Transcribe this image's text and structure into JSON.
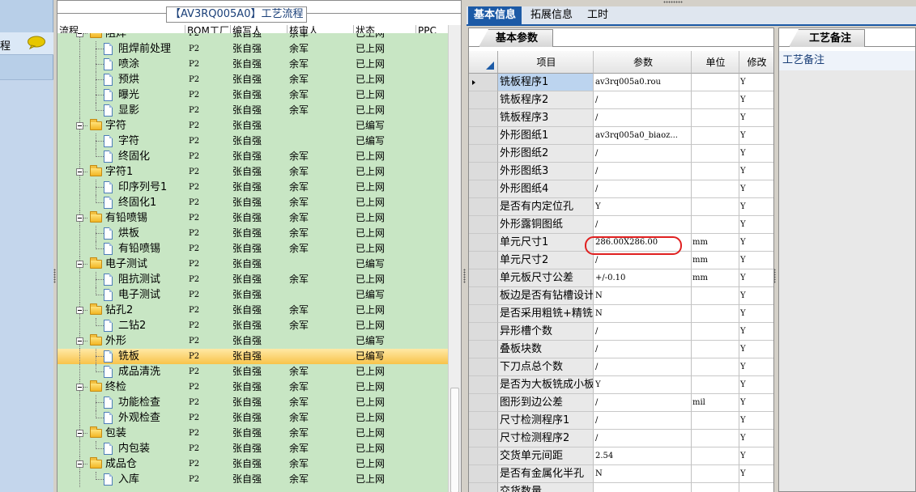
{
  "left_strip": {
    "title": "程"
  },
  "tree": {
    "caption": "【AV3RQ005A0】工艺流程",
    "columns": [
      "流程",
      "BOM工厂",
      "编写人",
      "核审人",
      "状态",
      "PPC"
    ],
    "rows": [
      {
        "level": 0,
        "type": "folder",
        "name": "阻焊",
        "bom": "P2",
        "writer": "张自强",
        "reviewer": "余军",
        "status": "已上网",
        "ppc": ""
      },
      {
        "level": 1,
        "type": "doc",
        "name": "阻焊前处理",
        "bom": "P2",
        "writer": "张自强",
        "reviewer": "余军",
        "status": "已上网",
        "ppc": ""
      },
      {
        "level": 1,
        "type": "doc",
        "name": "喷涂",
        "bom": "P2",
        "writer": "张自强",
        "reviewer": "余军",
        "status": "已上网",
        "ppc": ""
      },
      {
        "level": 1,
        "type": "doc",
        "name": "预烘",
        "bom": "P2",
        "writer": "张自强",
        "reviewer": "余军",
        "status": "已上网",
        "ppc": ""
      },
      {
        "level": 1,
        "type": "doc",
        "name": "曝光",
        "bom": "P2",
        "writer": "张自强",
        "reviewer": "余军",
        "status": "已上网",
        "ppc": ""
      },
      {
        "level": 1,
        "type": "doc",
        "name": "显影",
        "bom": "P2",
        "writer": "张自强",
        "reviewer": "余军",
        "status": "已上网",
        "ppc": ""
      },
      {
        "level": 0,
        "type": "folder",
        "name": "字符",
        "bom": "P2",
        "writer": "张自强",
        "reviewer": "",
        "status": "已编写",
        "ppc": ""
      },
      {
        "level": 1,
        "type": "doc",
        "name": "字符",
        "bom": "P2",
        "writer": "张自强",
        "reviewer": "",
        "status": "已编写",
        "ppc": ""
      },
      {
        "level": 1,
        "type": "doc",
        "name": "终固化",
        "bom": "P2",
        "writer": "张自强",
        "reviewer": "余军",
        "status": "已上网",
        "ppc": ""
      },
      {
        "level": 0,
        "type": "folder",
        "name": "字符1",
        "bom": "P2",
        "writer": "张自强",
        "reviewer": "余军",
        "status": "已上网",
        "ppc": ""
      },
      {
        "level": 1,
        "type": "doc",
        "name": "印序列号1",
        "bom": "P2",
        "writer": "张自强",
        "reviewer": "余军",
        "status": "已上网",
        "ppc": ""
      },
      {
        "level": 1,
        "type": "doc",
        "name": "终固化1",
        "bom": "P2",
        "writer": "张自强",
        "reviewer": "余军",
        "status": "已上网",
        "ppc": ""
      },
      {
        "level": 0,
        "type": "folder",
        "name": "有铅喷锡",
        "bom": "P2",
        "writer": "张自强",
        "reviewer": "余军",
        "status": "已上网",
        "ppc": ""
      },
      {
        "level": 1,
        "type": "doc",
        "name": "烘板",
        "bom": "P2",
        "writer": "张自强",
        "reviewer": "余军",
        "status": "已上网",
        "ppc": ""
      },
      {
        "level": 1,
        "type": "doc",
        "name": "有铅喷锡",
        "bom": "P2",
        "writer": "张自强",
        "reviewer": "余军",
        "status": "已上网",
        "ppc": ""
      },
      {
        "level": 0,
        "type": "folder",
        "name": "电子测试",
        "bom": "P2",
        "writer": "张自强",
        "reviewer": "",
        "status": "已编写",
        "ppc": ""
      },
      {
        "level": 1,
        "type": "doc",
        "name": "阻抗测试",
        "bom": "P2",
        "writer": "张自强",
        "reviewer": "余军",
        "status": "已上网",
        "ppc": ""
      },
      {
        "level": 1,
        "type": "doc",
        "name": "电子测试",
        "bom": "P2",
        "writer": "张自强",
        "reviewer": "",
        "status": "已编写",
        "ppc": ""
      },
      {
        "level": 0,
        "type": "folder",
        "name": "钻孔2",
        "bom": "P2",
        "writer": "张自强",
        "reviewer": "余军",
        "status": "已上网",
        "ppc": ""
      },
      {
        "level": 1,
        "type": "doc",
        "name": "二钻2",
        "bom": "P2",
        "writer": "张自强",
        "reviewer": "余军",
        "status": "已上网",
        "ppc": ""
      },
      {
        "level": 0,
        "type": "folder",
        "name": "外形",
        "bom": "P2",
        "writer": "张自强",
        "reviewer": "",
        "status": "已编写",
        "ppc": ""
      },
      {
        "level": 1,
        "type": "doc",
        "name": "铣板",
        "bom": "P2",
        "writer": "张自强",
        "reviewer": "",
        "status": "已编写",
        "ppc": "",
        "selected": true
      },
      {
        "level": 1,
        "type": "doc",
        "name": "成品清洗",
        "bom": "P2",
        "writer": "张自强",
        "reviewer": "余军",
        "status": "已上网",
        "ppc": ""
      },
      {
        "level": 0,
        "type": "folder",
        "name": "终检",
        "bom": "P2",
        "writer": "张自强",
        "reviewer": "余军",
        "status": "已上网",
        "ppc": ""
      },
      {
        "level": 1,
        "type": "doc",
        "name": "功能检查",
        "bom": "P2",
        "writer": "张自强",
        "reviewer": "余军",
        "status": "已上网",
        "ppc": ""
      },
      {
        "level": 1,
        "type": "doc",
        "name": "外观检查",
        "bom": "P2",
        "writer": "张自强",
        "reviewer": "余军",
        "status": "已上网",
        "ppc": ""
      },
      {
        "level": 0,
        "type": "folder",
        "name": "包装",
        "bom": "P2",
        "writer": "张自强",
        "reviewer": "余军",
        "status": "已上网",
        "ppc": ""
      },
      {
        "level": 1,
        "type": "doc",
        "name": "内包装",
        "bom": "P2",
        "writer": "张自强",
        "reviewer": "余军",
        "status": "已上网",
        "ppc": ""
      },
      {
        "level": 0,
        "type": "folder",
        "name": "成品仓",
        "bom": "P2",
        "writer": "张自强",
        "reviewer": "余军",
        "status": "已上网",
        "ppc": ""
      },
      {
        "level": 1,
        "type": "doc",
        "name": "入库",
        "bom": "P2",
        "writer": "张自强",
        "reviewer": "余军",
        "status": "已上网",
        "ppc": ""
      }
    ]
  },
  "tabs": [
    {
      "label": "基本信息",
      "active": true
    },
    {
      "label": "拓展信息",
      "active": false
    },
    {
      "label": "工时",
      "active": false
    }
  ],
  "basic_params": {
    "subtab": "基本参数",
    "columns": [
      "项目",
      "参数",
      "单位",
      "修改"
    ],
    "rows": [
      {
        "name": "铣板程序1",
        "param": "av3rq005a0.rou",
        "unit": "",
        "mod": "Y",
        "current": true
      },
      {
        "name": "铣板程序2",
        "param": "/",
        "unit": "",
        "mod": "Y"
      },
      {
        "name": "铣板程序3",
        "param": "/",
        "unit": "",
        "mod": "Y"
      },
      {
        "name": "外形图纸1",
        "param": "av3rq005a0_biaoz...",
        "unit": "",
        "mod": "Y"
      },
      {
        "name": "外形图纸2",
        "param": "/",
        "unit": "",
        "mod": "Y"
      },
      {
        "name": "外形图纸3",
        "param": "/",
        "unit": "",
        "mod": "Y"
      },
      {
        "name": "外形图纸4",
        "param": "/",
        "unit": "",
        "mod": "Y"
      },
      {
        "name": "是否有内定位孔",
        "param": "Y",
        "unit": "",
        "mod": "Y"
      },
      {
        "name": "外形露铜图纸",
        "param": "/",
        "unit": "",
        "mod": "Y"
      },
      {
        "name": "单元尺寸1",
        "param": "286.00X286.00",
        "unit": "mm",
        "mod": "Y",
        "highlight": true
      },
      {
        "name": "单元尺寸2",
        "param": "/",
        "unit": "mm",
        "mod": "Y"
      },
      {
        "name": "单元板尺寸公差",
        "param": "+/-0.10",
        "unit": "mm",
        "mod": "Y"
      },
      {
        "name": "板边是否有钻槽设计",
        "param": "N",
        "unit": "",
        "mod": "Y"
      },
      {
        "name": "是否采用粗铣+精铣",
        "param": "N",
        "unit": "",
        "mod": "Y"
      },
      {
        "name": "异形槽个数",
        "param": "/",
        "unit": "",
        "mod": "Y"
      },
      {
        "name": "叠板块数",
        "param": "/",
        "unit": "",
        "mod": "Y"
      },
      {
        "name": "下刀点总个数",
        "param": "/",
        "unit": "",
        "mod": "Y"
      },
      {
        "name": "是否为大板铣成小板",
        "param": "Y",
        "unit": "",
        "mod": "Y"
      },
      {
        "name": "图形到边公差",
        "param": "/",
        "unit": "mil",
        "mod": "Y"
      },
      {
        "name": "尺寸检测程序1",
        "param": "/",
        "unit": "",
        "mod": "Y"
      },
      {
        "name": "尺寸检测程序2",
        "param": "/",
        "unit": "",
        "mod": "Y"
      },
      {
        "name": "交货单元间距",
        "param": "2.54",
        "unit": "",
        "mod": "Y"
      },
      {
        "name": "是否有金属化半孔",
        "param": "N",
        "unit": "",
        "mod": "Y"
      },
      {
        "name": "交货数量",
        "param": "",
        "unit": "",
        "mod": ""
      }
    ]
  },
  "notes": {
    "tab": "工艺备注",
    "header": "工艺备注"
  },
  "colors": {
    "tree_bg": "#c8e6c4",
    "tab_active": "#1c5aa6",
    "selected_row": "#f8c34a",
    "highlight_oval": "#e02020"
  }
}
